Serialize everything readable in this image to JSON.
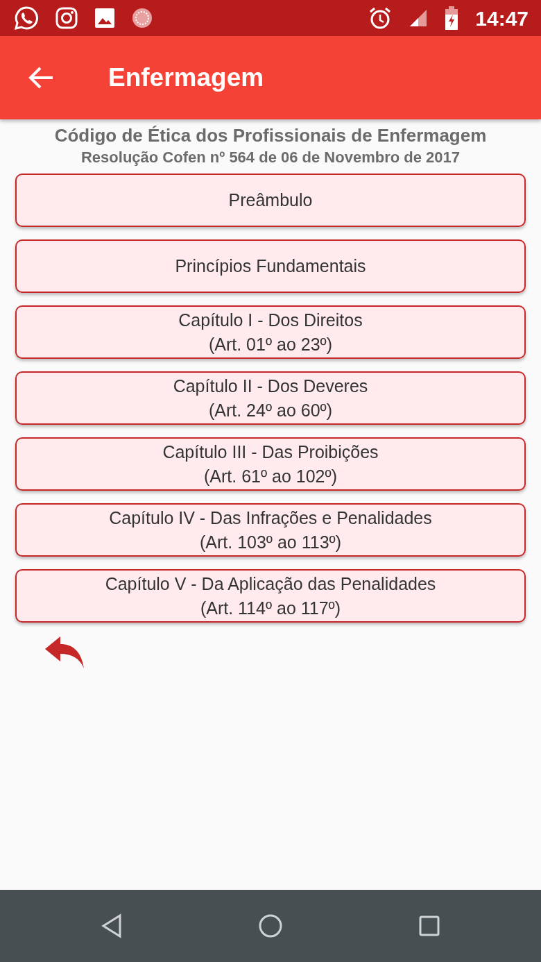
{
  "status_bar": {
    "time": "14:47"
  },
  "app_bar": {
    "title": "Enfermagem"
  },
  "heading": {
    "title": "Código de Ética dos Profissionais de Enfermagem",
    "subtitle": "Resolução Cofen nº 564 de 06 de Novembro de 2017"
  },
  "sections": [
    {
      "lines": [
        "Preâmbulo"
      ]
    },
    {
      "lines": [
        "Princípios Fundamentais"
      ]
    },
    {
      "lines": [
        "Capítulo I - Dos Direitos",
        "(Art. 01º ao 23º)"
      ]
    },
    {
      "lines": [
        "Capítulo II - Dos Deveres",
        "(Art. 24º ao 60º)"
      ]
    },
    {
      "lines": [
        "Capítulo III - Das Proibições",
        "(Art. 61º ao 102º)"
      ]
    },
    {
      "lines": [
        "Capítulo IV - Das Infrações e Penalidades",
        "(Art. 103º ao 113º)"
      ]
    },
    {
      "lines": [
        "Capítulo V - Da Aplicação das Penalidades",
        "(Art. 114º ao 117º)"
      ]
    }
  ]
}
